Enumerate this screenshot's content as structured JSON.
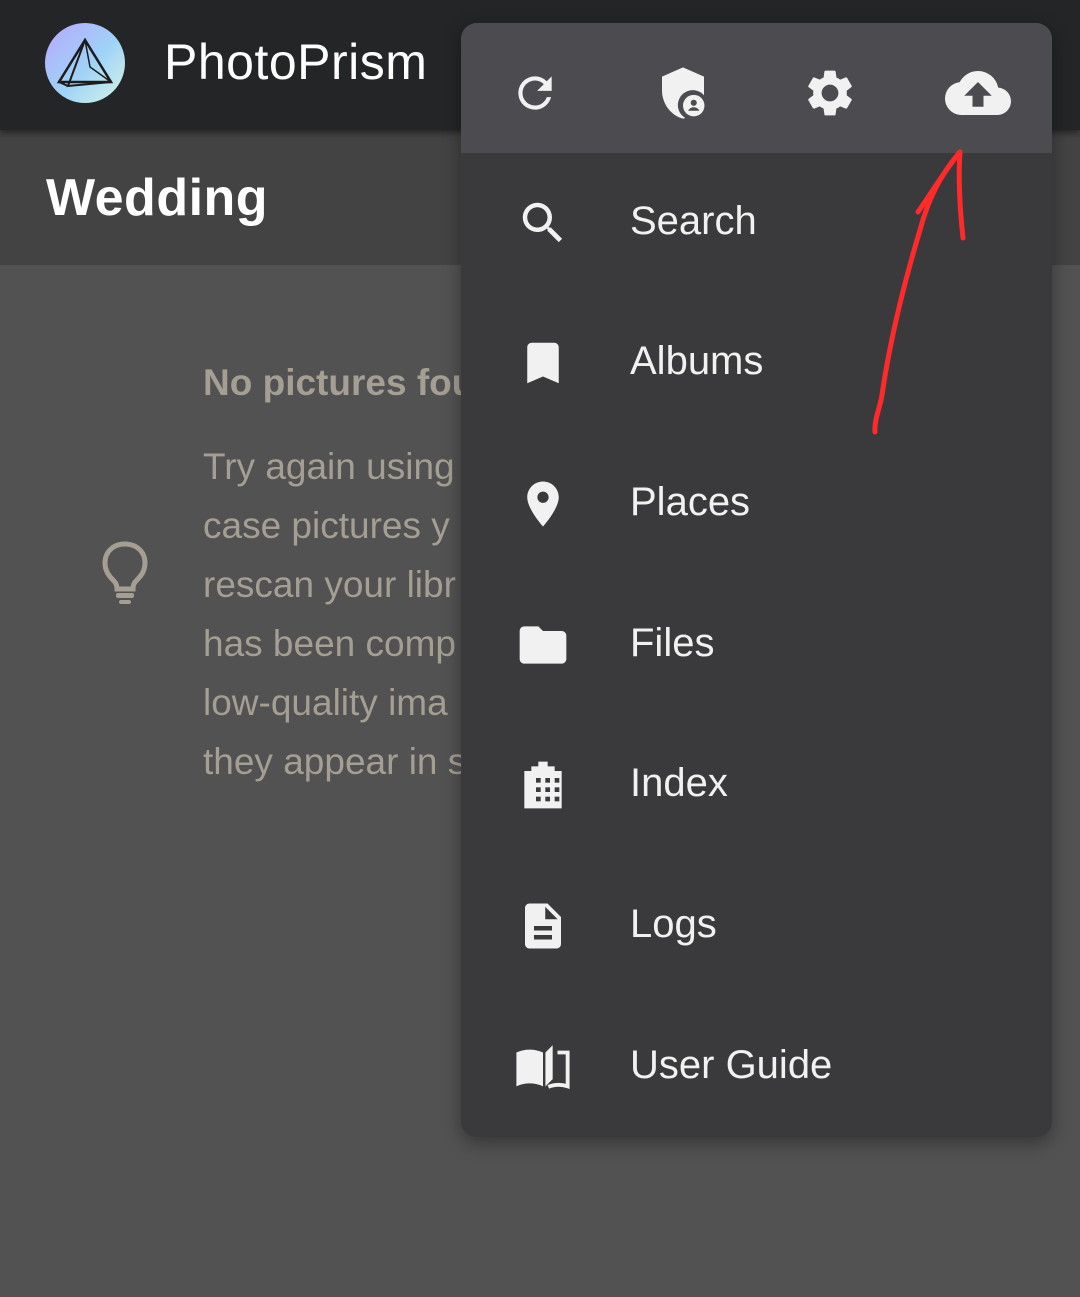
{
  "app": {
    "title": "PhotoPrism"
  },
  "page": {
    "title": "Wedding"
  },
  "empty_state": {
    "title": "No pictures fou",
    "lines": [
      "Try again using",
      "case pictures y",
      "rescan your libr",
      "has been comp",
      "low-quality ima",
      "they appear in s"
    ]
  },
  "menu": {
    "items": [
      {
        "label": "Search",
        "icon": "search-icon"
      },
      {
        "label": "Albums",
        "icon": "bookmark-icon"
      },
      {
        "label": "Places",
        "icon": "location-pin-icon"
      },
      {
        "label": "Files",
        "icon": "folder-icon"
      },
      {
        "label": "Index",
        "icon": "film-icon"
      },
      {
        "label": "Logs",
        "icon": "document-icon"
      },
      {
        "label": "User Guide",
        "icon": "book-open-icon"
      }
    ],
    "top_actions": [
      "refresh-icon",
      "admin-shield-icon",
      "settings-gear-icon",
      "cloud-upload-icon"
    ]
  },
  "colors": {
    "topbar": "#232527",
    "subbar": "#434343",
    "background": "#525252",
    "menu": "#3a3a3c",
    "menu_header": "#4c4c50",
    "annotation_arrow": "#ff2a2a"
  }
}
